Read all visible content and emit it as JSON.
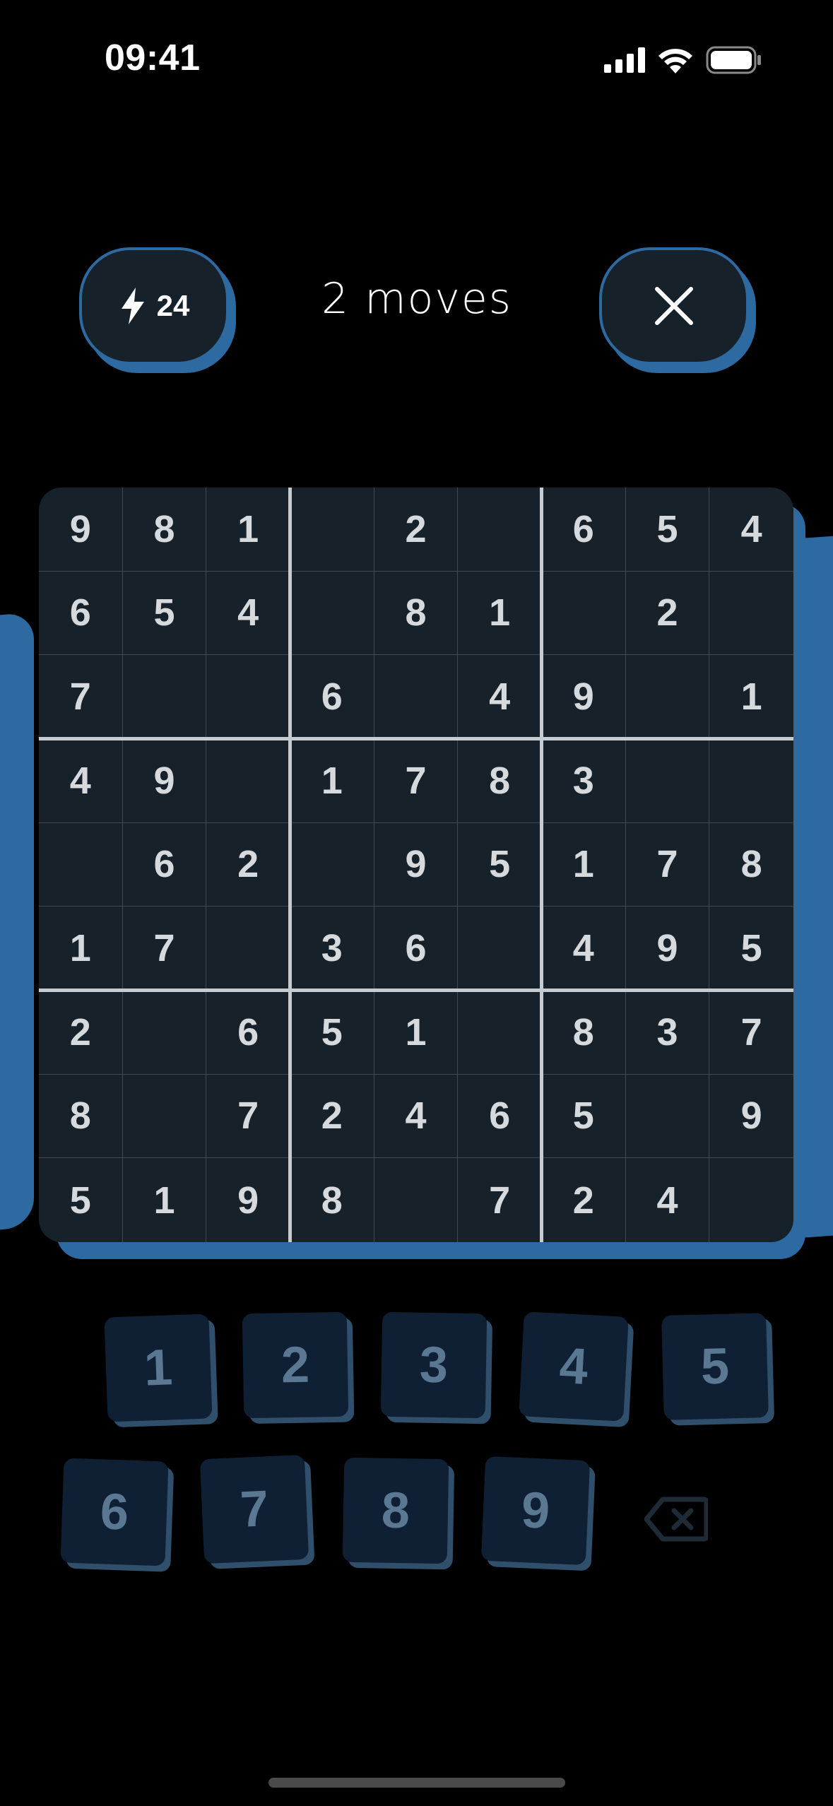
{
  "status_bar": {
    "time": "09:41"
  },
  "header": {
    "energy_count": "24",
    "moves_label": "2 moves"
  },
  "board": {
    "rows": [
      [
        "9",
        "8",
        "1",
        "",
        "2",
        "",
        "6",
        "5",
        "4"
      ],
      [
        "6",
        "5",
        "4",
        "",
        "8",
        "1",
        "",
        "2",
        ""
      ],
      [
        "7",
        "",
        "",
        "6",
        "",
        "4",
        "9",
        "",
        "1"
      ],
      [
        "4",
        "9",
        "",
        "1",
        "7",
        "8",
        "3",
        "",
        ""
      ],
      [
        "",
        "6",
        "2",
        "",
        "9",
        "5",
        "1",
        "7",
        "8"
      ],
      [
        "1",
        "7",
        "",
        "3",
        "6",
        "",
        "4",
        "9",
        "5"
      ],
      [
        "2",
        "",
        "6",
        "5",
        "1",
        "",
        "8",
        "3",
        "7"
      ],
      [
        "8",
        "",
        "7",
        "2",
        "4",
        "6",
        "5",
        "",
        "9"
      ],
      [
        "5",
        "1",
        "9",
        "8",
        "",
        "7",
        "2",
        "4",
        ""
      ]
    ]
  },
  "numpad": {
    "keys": [
      "1",
      "2",
      "3",
      "4",
      "5",
      "6",
      "7",
      "8",
      "9"
    ]
  },
  "colors": {
    "accent": "#2d6aa1",
    "board_bg": "#17212a",
    "key_bg": "#0f2035",
    "key_text": "#5a7892"
  },
  "icons": {
    "energy": "bolt-icon",
    "close": "close-icon",
    "backspace": "backspace-icon"
  }
}
